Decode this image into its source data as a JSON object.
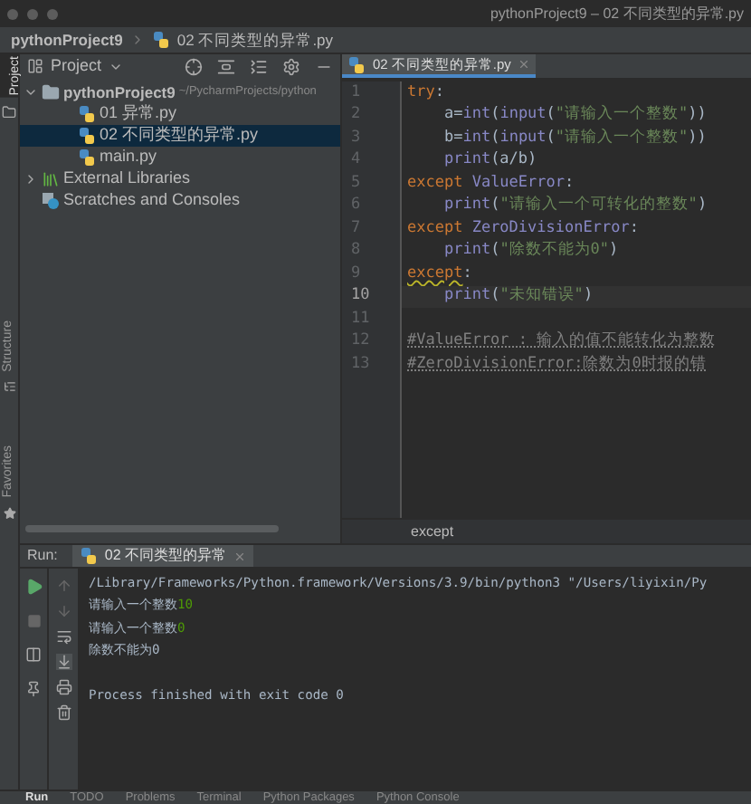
{
  "window": {
    "title": "pythonProject9 – 02 不同类型的异常.py"
  },
  "breadcrumb": [
    "pythonProject9",
    "02 不同类型的异常.py"
  ],
  "left_strip": [
    {
      "label": "Project",
      "selected": true
    },
    {
      "label": "Structure",
      "selected": false
    },
    {
      "label": "Favorites",
      "selected": false
    }
  ],
  "project_panel": {
    "title": "Project",
    "tree": [
      {
        "label": "pythonProject9",
        "hint": "~/PycharmProjects/python",
        "kind": "folder",
        "expanded": true,
        "selected": false,
        "children": [
          {
            "label": "01 异常.py",
            "kind": "pyfile",
            "selected": false
          },
          {
            "label": "02 不同类型的异常.py",
            "kind": "pyfile",
            "selected": true
          },
          {
            "label": "main.py",
            "kind": "pyfile",
            "selected": false
          }
        ]
      },
      {
        "label": "External Libraries",
        "kind": "library",
        "expanded": false,
        "selected": false
      },
      {
        "label": "Scratches and Consoles",
        "kind": "scratch",
        "selected": false
      }
    ]
  },
  "editor": {
    "tab": "02 不同类型的异常.py",
    "lines": [
      {
        "number": "1",
        "current": false,
        "segments": [
          {
            "text": "try",
            "kind": "keyword"
          },
          {
            "text": ":",
            "kind": "plain"
          }
        ]
      },
      {
        "number": "2",
        "current": false,
        "segments": [
          {
            "text": "    a=",
            "kind": "plain"
          },
          {
            "text": "int",
            "kind": "builtin"
          },
          {
            "text": "(",
            "kind": "plain"
          },
          {
            "text": "input",
            "kind": "builtin"
          },
          {
            "text": "(",
            "kind": "plain"
          },
          {
            "text": "\"请输入一个整数\"",
            "kind": "string"
          },
          {
            "text": "))",
            "kind": "plain"
          }
        ]
      },
      {
        "number": "3",
        "current": false,
        "segments": [
          {
            "text": "    b=",
            "kind": "plain"
          },
          {
            "text": "int",
            "kind": "builtin"
          },
          {
            "text": "(",
            "kind": "plain"
          },
          {
            "text": "input",
            "kind": "builtin"
          },
          {
            "text": "(",
            "kind": "plain"
          },
          {
            "text": "\"请输入一个整数\"",
            "kind": "string"
          },
          {
            "text": "))",
            "kind": "plain"
          }
        ]
      },
      {
        "number": "4",
        "current": false,
        "segments": [
          {
            "text": "    print",
            "kind": "builtin"
          },
          {
            "text": "(a/b)",
            "kind": "plain"
          }
        ]
      },
      {
        "number": "5",
        "current": false,
        "segments": [
          {
            "text": "except ",
            "kind": "keyword"
          },
          {
            "text": "ValueError",
            "kind": "builtin"
          },
          {
            "text": ":",
            "kind": "plain"
          }
        ]
      },
      {
        "number": "6",
        "current": false,
        "segments": [
          {
            "text": "    print",
            "kind": "builtin"
          },
          {
            "text": "(",
            "kind": "plain"
          },
          {
            "text": "\"请输入一个可转化的整数\"",
            "kind": "string"
          },
          {
            "text": ")",
            "kind": "plain"
          }
        ]
      },
      {
        "number": "7",
        "current": false,
        "segments": [
          {
            "text": "except ",
            "kind": "keyword"
          },
          {
            "text": "ZeroDivisionError",
            "kind": "builtin"
          },
          {
            "text": ":",
            "kind": "plain"
          }
        ]
      },
      {
        "number": "8",
        "current": false,
        "segments": [
          {
            "text": "    print",
            "kind": "builtin"
          },
          {
            "text": "(",
            "kind": "plain"
          },
          {
            "text": "\"除数不能为0\"",
            "kind": "string"
          },
          {
            "text": ")",
            "kind": "plain"
          }
        ]
      },
      {
        "number": "9",
        "current": false,
        "segments": [
          {
            "text": "except",
            "kind": "warn"
          },
          {
            "text": ":",
            "kind": "plain"
          }
        ]
      },
      {
        "number": "10",
        "current": true,
        "segments": [
          {
            "text": "    print",
            "kind": "builtin"
          },
          {
            "text": "(",
            "kind": "plain"
          },
          {
            "text": "\"未知错误\"",
            "kind": "string"
          },
          {
            "text": ")",
            "kind": "plain"
          }
        ]
      },
      {
        "number": "11",
        "current": false
      },
      {
        "number": "12",
        "current": false,
        "segments": [
          {
            "text": "#ValueError : 输入的值不能转化为整数",
            "kind": "comment"
          }
        ]
      },
      {
        "number": "13",
        "current": false,
        "segments": [
          {
            "text": "#ZeroDivisionError:除数为0时报的错",
            "kind": "comment"
          }
        ]
      }
    ],
    "crumb": "except"
  },
  "run": {
    "label": "Run:",
    "tab": "02 不同类型的异常",
    "output": [
      {
        "kind": "output",
        "segments": [
          {
            "text": "/Library/Frameworks/Python.framework/Versions/3.9/bin/python3 \"/Users/liyixin/Py",
            "kind": "plain"
          }
        ]
      },
      {
        "kind": "output",
        "segments": [
          {
            "text": "请输入一个整数",
            "kind": "plain"
          },
          {
            "text": "10",
            "kind": "input"
          }
        ]
      },
      {
        "kind": "output",
        "segments": [
          {
            "text": "请输入一个整数",
            "kind": "plain"
          },
          {
            "text": "0",
            "kind": "input"
          }
        ]
      },
      {
        "kind": "output",
        "segments": [
          {
            "text": "除数不能为0",
            "kind": "plain"
          }
        ]
      },
      {
        "kind": "status",
        "segments": [
          {
            "text": "Process finished with exit code 0",
            "kind": "plain"
          }
        ]
      }
    ]
  },
  "bottom_bar": [
    {
      "label": "Run",
      "selected": true
    },
    {
      "label": "TODO",
      "selected": false
    },
    {
      "label": "Problems",
      "selected": false
    },
    {
      "label": "Terminal",
      "selected": false
    },
    {
      "label": "Python Packages",
      "selected": false
    },
    {
      "label": "Python Console",
      "selected": false
    }
  ]
}
